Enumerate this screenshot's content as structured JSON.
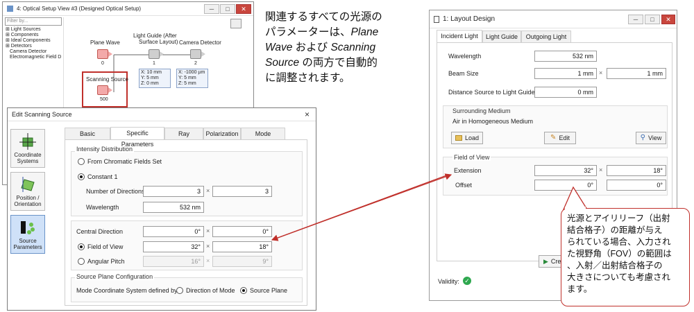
{
  "optical_window": {
    "title": "4: Optical Setup View #3 (Designed Optical Setup)",
    "filter_placeholder": "Filter by...",
    "tree": [
      "Light Sources",
      "Components",
      "Ideal Components",
      "Detectors",
      "Camera Detector",
      "Electromagnetic Field D"
    ],
    "nodes": {
      "plane_wave": {
        "label": "Plane Wave",
        "count": "0"
      },
      "light_guide": {
        "label_line1": "Light Guide (After",
        "label_line2": "Surface Layout)",
        "count": "1"
      },
      "camera": {
        "label": "Camera Detector",
        "count": "2"
      },
      "scanning": {
        "label": "Scanning Source",
        "count": "500"
      }
    },
    "info1": [
      "X: 10 mm",
      "Y: 5 mm",
      "Z: 0 mm"
    ],
    "info2": [
      "X: -1000 µm",
      "Y: 5 mm",
      "Z: 5 mm"
    ]
  },
  "description": {
    "line1": "関連するすべての光源の",
    "line2": "パラメーターは、",
    "line2_em": "Plane",
    "line3_em": "Wave",
    "line3": " および ",
    "line3_em2": "Scanning",
    "line4_em": "Source",
    "line4": " の両方で自動的",
    "line5": "に調整されます。"
  },
  "edit_dialog": {
    "title": "Edit Scanning Source",
    "close": "×",
    "side": [
      {
        "label_line1": "Coordinate",
        "label_line2": "Systems"
      },
      {
        "label_line1": "Position /",
        "label_line2": "Orientation"
      },
      {
        "label_line1": "Source",
        "label_line2": "Parameters"
      }
    ],
    "tabs": [
      "Basic Parameters",
      "Specific Parameters",
      "Ray Selection",
      "Polarization",
      "Mode Selection"
    ],
    "intensity_title": "Intensity Distribution",
    "from_chromatic": "From Chromatic Fields Set",
    "constant": "Constant 1",
    "num_dirs_label": "Number of Directions",
    "num_dirs": [
      "3",
      "3"
    ],
    "wavelength_label": "Wavelength",
    "wavelength": "532 nm",
    "central_label": "Central Direction",
    "central": [
      "0°",
      "0°"
    ],
    "fov_label": "Field of View",
    "fov": [
      "32°",
      "18°"
    ],
    "angular_label": "Angular Pitch",
    "angular": [
      "16°",
      "9°"
    ],
    "times": "×",
    "plane_title": "Source Plane Configuration",
    "mode_label": "Mode Coordinate System defined by",
    "dir_mode": "Direction of Mode",
    "src_plane": "Source Plane"
  },
  "layout_window": {
    "title": "1: Layout Design",
    "tabs": [
      "Incident Light",
      "Light Guide",
      "Outgoing Light"
    ],
    "wavelength_label": "Wavelength",
    "wavelength": "532 nm",
    "beam_label": "Beam Size",
    "beam": [
      "1 mm",
      "1 mm"
    ],
    "distance_label": "Distance Source to Light Guide",
    "distance": "0 mm",
    "medium_title": "Surrounding Medium",
    "medium_value": "Air in Homogeneous Medium",
    "load": "Load",
    "edit": "Edit",
    "view": "View",
    "fov_title": "Field of View",
    "extension_label": "Extension",
    "extension": [
      "32°",
      "18°"
    ],
    "offset_label": "Offset",
    "offset": [
      "0°",
      "0°"
    ],
    "times": "×",
    "create_partial": "Cre",
    "validity": "Validity:"
  },
  "callout": {
    "lines": [
      "光源とアイリリーフ（出射",
      "結合格子）の距離が与え",
      "られている場合、入力され",
      "た視野角（FOV）の範囲は",
      "、入射／出射結合格子の",
      "大きさについても考慮され",
      "ます。"
    ]
  },
  "colors": {
    "callout_border": "#c0302b",
    "arrow": "#c0302b",
    "validity": "#2fa84f",
    "selected_side": "#cfe1f8"
  }
}
